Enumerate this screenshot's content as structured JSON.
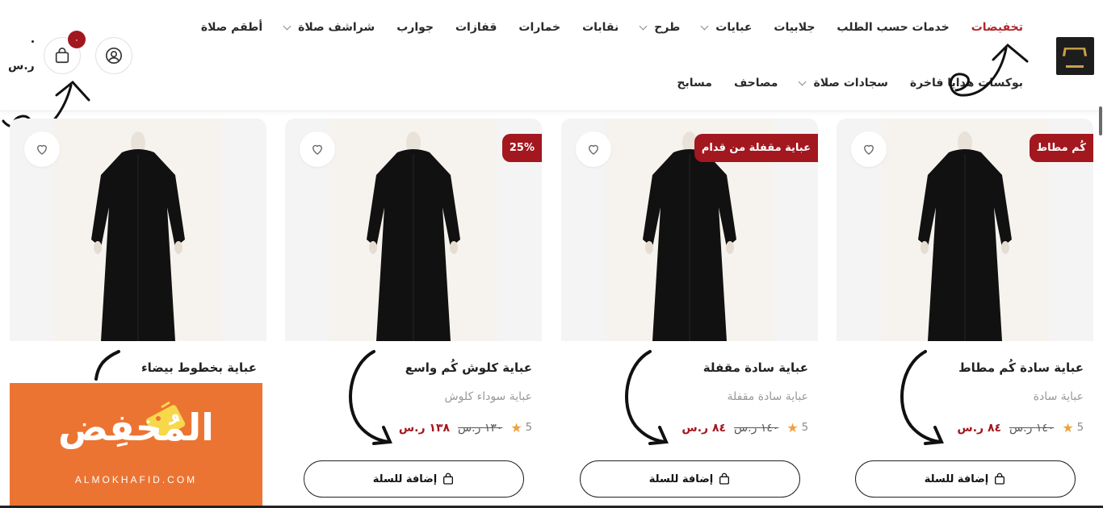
{
  "header": {
    "nav_row1": [
      {
        "label": "تخفيضات",
        "active": true,
        "dropdown": false
      },
      {
        "label": "خدمات حسب الطلب",
        "active": false,
        "dropdown": false
      },
      {
        "label": "جلابيات",
        "active": false,
        "dropdown": false
      },
      {
        "label": "عبايات",
        "active": false,
        "dropdown": true
      },
      {
        "label": "طرح",
        "active": false,
        "dropdown": true
      },
      {
        "label": "نقابات",
        "active": false,
        "dropdown": false
      },
      {
        "label": "خمارات",
        "active": false,
        "dropdown": false
      },
      {
        "label": "قفازات",
        "active": false,
        "dropdown": false
      },
      {
        "label": "جوارب",
        "active": false,
        "dropdown": false
      },
      {
        "label": "شراشف صلاة",
        "active": false,
        "dropdown": true
      },
      {
        "label": "أطقم صلاة",
        "active": false,
        "dropdown": false
      }
    ],
    "nav_row2": [
      {
        "label": "بوكسات هدايا فاخرة",
        "active": false,
        "dropdown": false
      },
      {
        "label": "سجادات صلاة",
        "active": false,
        "dropdown": true
      },
      {
        "label": "مصاحف",
        "active": false,
        "dropdown": false
      },
      {
        "label": "مسابح",
        "active": false,
        "dropdown": false
      }
    ],
    "cart_count": "٠",
    "cart_total": "ر.س"
  },
  "products": [
    {
      "title": "عباية سادة كُم مطاط",
      "subtitle": "عباية سادة",
      "price": "٨٤ ر.س",
      "old_price": "١٤٠ ر.س",
      "rating": "5",
      "badge": "كُم مطاط",
      "add_label": "إضافة للسلة"
    },
    {
      "title": "عباية سادة مقفلة",
      "subtitle": "عباية سادة مقفلة",
      "price": "٨٤ ر.س",
      "old_price": "١٤٠ ر.س",
      "rating": "5",
      "badge": "عباية مقفلة من قدام",
      "add_label": "إضافة للسلة"
    },
    {
      "title": "عباية كلوش كُم واسع",
      "subtitle": "عباية سوداء كلوش",
      "price": "١٣٨ ر.س",
      "old_price": "١٣٠ ر.س",
      "rating": "5",
      "badge": "25%",
      "add_label": "إضافة للسلة"
    },
    {
      "title": "عباية بخطوط بيضاء",
      "subtitle": "",
      "price": "",
      "old_price": "",
      "rating": "",
      "badge": "",
      "add_label": ""
    }
  ],
  "promo": {
    "word": "المُخفِض",
    "subtitle": "ALMOKHAFID.COM"
  },
  "colors": {
    "accent": "#a3171f",
    "promo_bg": "#ec7433",
    "star": "#f0a23a"
  }
}
